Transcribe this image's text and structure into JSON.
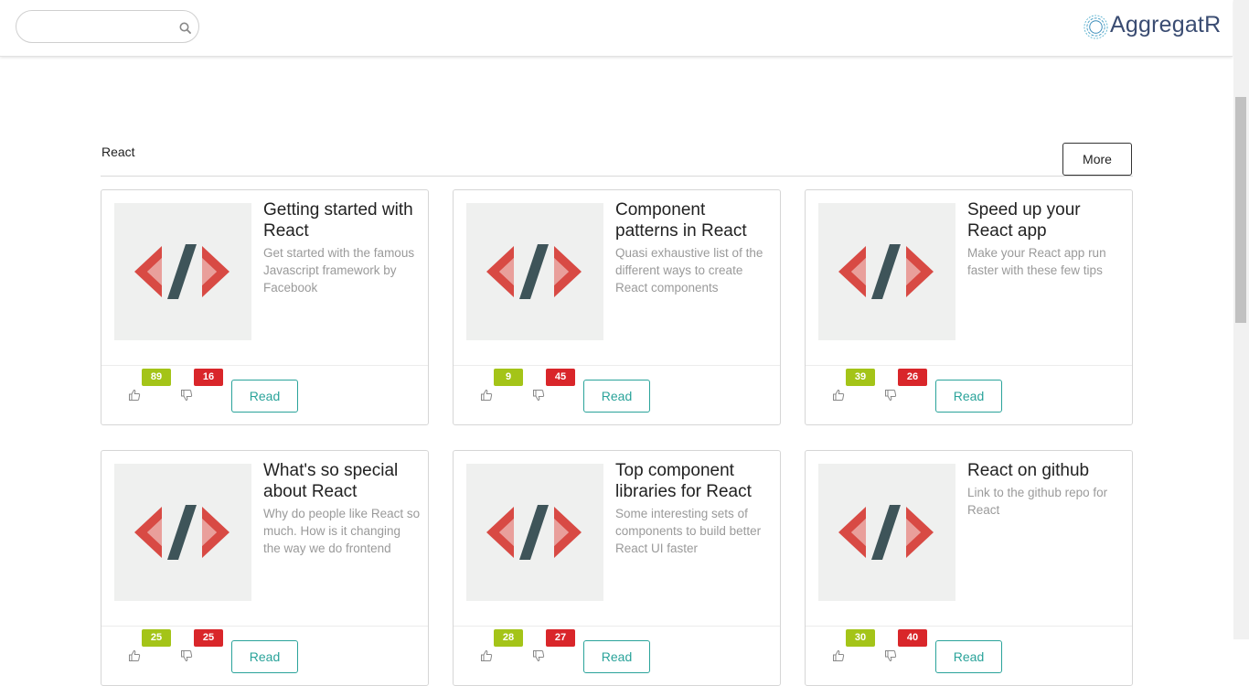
{
  "header": {
    "search_placeholder": "",
    "logo_text": "AggregatR"
  },
  "section": {
    "title": "React",
    "more_label": "More"
  },
  "cards": [
    {
      "title": "Getting started with React",
      "desc": "Get started with the famous Javascript framework by Facebook",
      "up": "89",
      "down": "16",
      "read_label": "Read"
    },
    {
      "title": "Component patterns in React",
      "desc": "Quasi exhaustive list of the different ways to create React components",
      "up": "9",
      "down": "45",
      "read_label": "Read"
    },
    {
      "title": "Speed up your React app",
      "desc": "Make your React app run faster with these few tips",
      "up": "39",
      "down": "26",
      "read_label": "Read"
    },
    {
      "title": "What's so special about React",
      "desc": "Why do people like React so much. How is it changing the way we do frontend",
      "up": "25",
      "down": "25",
      "read_label": "Read"
    },
    {
      "title": "Top component libraries for React",
      "desc": "Some interesting sets of components to build better React UI faster",
      "up": "28",
      "down": "27",
      "read_label": "Read"
    },
    {
      "title": "React on github",
      "desc": "Link to the github repo for React",
      "up": "30",
      "down": "40",
      "read_label": "Read"
    }
  ],
  "colors": {
    "accent": "#2aa39a",
    "upvote": "#a4c418",
    "downvote": "#d9262a",
    "logo": "#3a4c72"
  },
  "icons": {
    "search": "search-icon",
    "logo": "aggregatr-logo-icon",
    "thumbnail": "code-brackets-icon",
    "like": "thumbs-up-icon",
    "dislike": "thumbs-down-icon"
  }
}
